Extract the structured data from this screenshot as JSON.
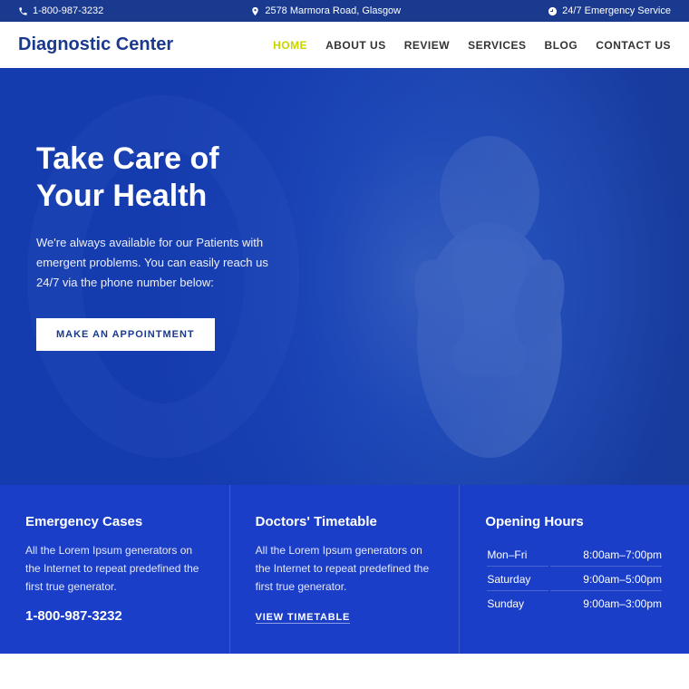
{
  "topbar": {
    "phone": "1-800-987-3232",
    "address": "2578 Marmora Road, Glasgow",
    "emergency": "24/7 Emergency Service"
  },
  "navbar": {
    "logo": "Diagnostic Center",
    "links": [
      {
        "label": "HOME",
        "active": true
      },
      {
        "label": "ABOUT US",
        "active": false
      },
      {
        "label": "REVIEW",
        "active": false
      },
      {
        "label": "SERVICES",
        "active": false
      },
      {
        "label": "BLOG",
        "active": false
      },
      {
        "label": "CONTACT US",
        "active": false
      }
    ]
  },
  "hero": {
    "heading": "Take Care of Your Health",
    "description": "We're always available for our Patients with emergent problems. You can easily reach us 24/7 via the phone number below:",
    "button": "MAKE AN APPOINTMENT"
  },
  "info": {
    "cards": [
      {
        "title": "Emergency Cases",
        "text": "All the Lorem Ipsum generators on the Internet to repeat predefined the first true generator.",
        "phone": "1-800-987-3232",
        "type": "emergency"
      },
      {
        "title": "Doctors' Timetable",
        "text": "All the Lorem Ipsum generators on the Internet to repeat predefined the first true generator.",
        "link": "VIEW TIMETABLE",
        "type": "timetable"
      },
      {
        "title": "Opening Hours",
        "type": "hours",
        "hours": [
          {
            "day": "Mon–Fri",
            "time": "8:00am–7:00pm"
          },
          {
            "day": "Saturday",
            "time": "9:00am–5:00pm"
          },
          {
            "day": "Sunday",
            "time": "9:00am–3:00pm"
          }
        ]
      }
    ]
  }
}
